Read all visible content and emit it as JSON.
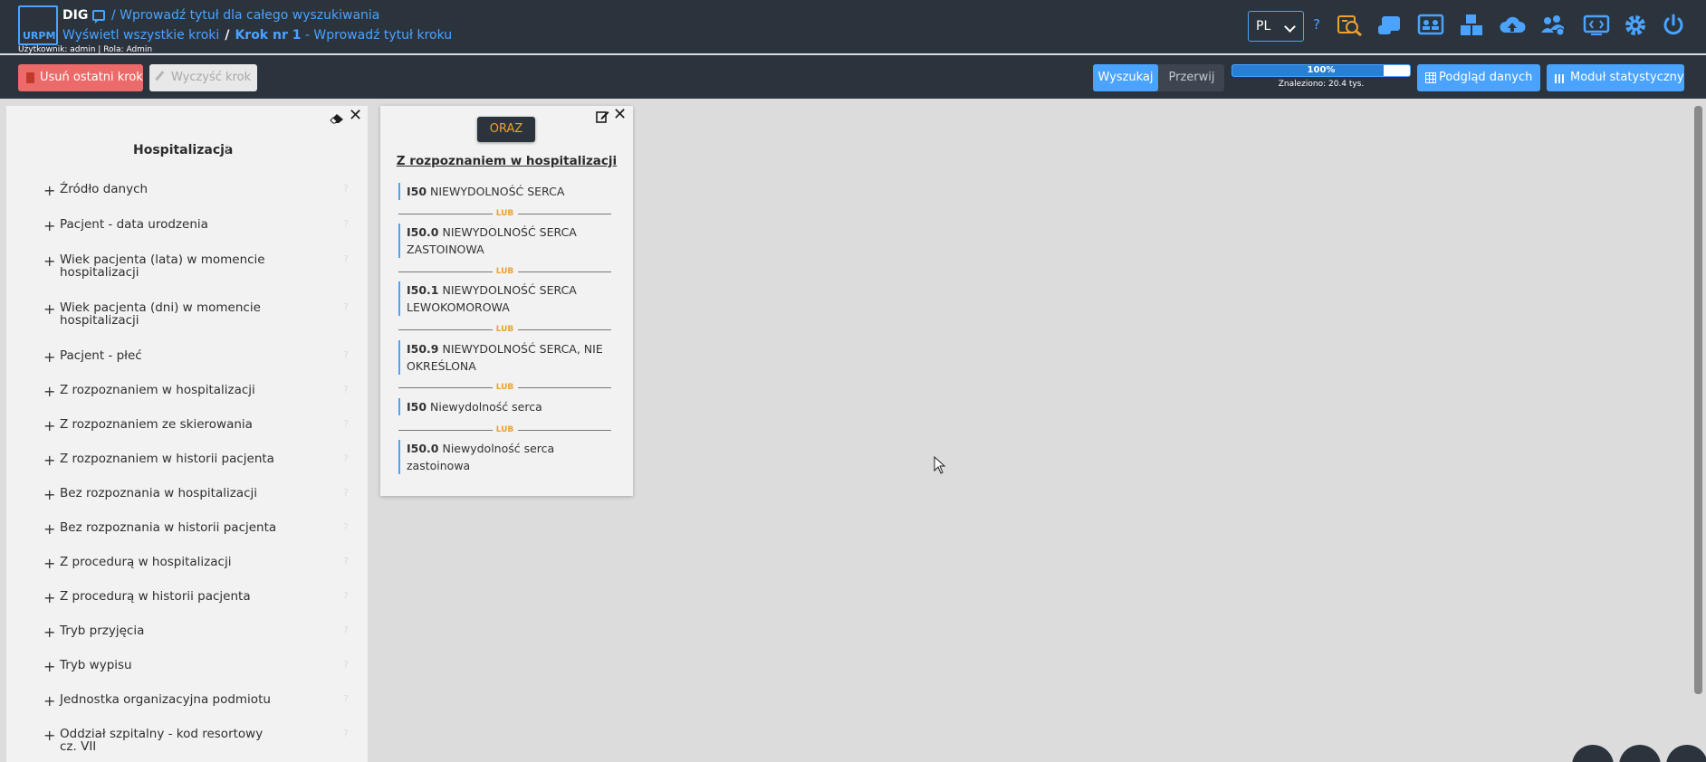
{
  "header": {
    "logo_text": "URPM",
    "app_name": "DIG",
    "search_title": "/ Wprowadź tytuł dla całego wyszukiwania",
    "show_all_steps": "Wyświetl wszystkie kroki",
    "breadcrumb_sep": "/",
    "step_number": "Krok nr 1",
    "step_title": " - Wprowadź tytuł kroku",
    "user_info": "Użytkownik: admin | Rola: Admin",
    "language": "PL",
    "help": "?",
    "icons": [
      "search-report-icon",
      "scroll-icon",
      "users-board-icon",
      "boxes-icon",
      "cloud-upload-icon",
      "users-gear-icon",
      "code-window-icon",
      "gear-icon",
      "power-icon"
    ]
  },
  "toolbar": {
    "delete_last_step": "Usuń ostatni krok",
    "clear_step": "Wyczyść krok",
    "search": "Wyszukaj",
    "stop": "Przerwij",
    "progress_label": "100%",
    "progress_value": 0.85,
    "found": "Znaleziono: 20.4 tys.",
    "data_preview": "Podgląd danych",
    "stats_module": "Moduł statystyczny"
  },
  "left_panel": {
    "category": "Hospitalizacja",
    "help": "?",
    "items": [
      {
        "label": "Źródło danych"
      },
      {
        "label": "Pacjent - data urodzenia"
      },
      {
        "label": "Wiek pacjenta (lata) w momencie hospitalizacji"
      },
      {
        "label": "Wiek pacjenta (dni) w momencie hospitalizacji"
      },
      {
        "label": "Pacjent - płeć"
      },
      {
        "label": "Z rozpoznaniem w hospitalizacji"
      },
      {
        "label": "Z rozpoznaniem ze skierowania"
      },
      {
        "label": "Z rozpoznaniem w historii pacjenta"
      },
      {
        "label": "Bez rozpoznania w hospitalizacji"
      },
      {
        "label": "Bez rozpoznania w historii pacjenta"
      },
      {
        "label": "Z procedurą w hospitalizacji"
      },
      {
        "label": "Z procedurą w historii pacjenta"
      },
      {
        "label": "Tryb przyjęcia"
      },
      {
        "label": "Tryb wypisu"
      },
      {
        "label": "Jednostka organizacyjna podmiotu"
      },
      {
        "label": "Oddział szpitalny - kod resortowy cz. VII"
      }
    ]
  },
  "criterion_card": {
    "operator": "ORAZ",
    "title": "Z rozpoznaniem w hospitalizacji",
    "or_label": "LUB",
    "codes": [
      {
        "code": "I50",
        "name": "NIEWYDOLNOŚĆ SERCA"
      },
      {
        "code": "I50.0",
        "name": "NIEWYDOLNOŚĆ SERCA ZASTOINOWA"
      },
      {
        "code": "I50.1",
        "name": "NIEWYDOLNOŚĆ SERCA LEWOKOMOROWA"
      },
      {
        "code": "I50.9",
        "name": "NIEWYDOLNOŚĆ SERCA, NIE OKREŚLONA"
      },
      {
        "code": "I50",
        "name": "Niewydolność serca"
      },
      {
        "code": "I50.0",
        "name": "Niewydolność serca zastoinowa"
      }
    ]
  },
  "colors": {
    "header_bg": "#2b333d",
    "accent": "#4aa3ff",
    "danger": "#ec6a6a",
    "operator": "#f0a030",
    "panel_bg": "#f2f2f2",
    "canvas_bg": "#dcdcdc"
  }
}
